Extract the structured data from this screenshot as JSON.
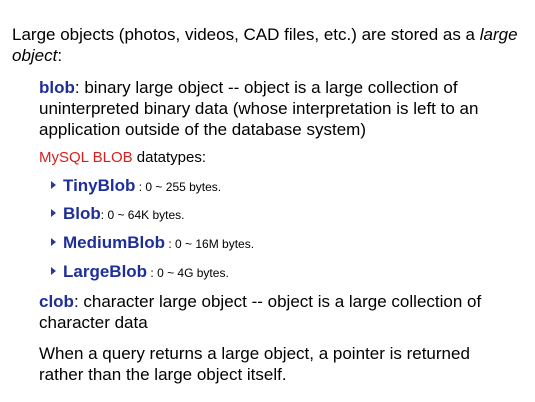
{
  "intro": {
    "text_before": "Large objects (photos, videos, CAD files, etc.) are stored as a ",
    "italic": "large object",
    "text_after": ":"
  },
  "blob": {
    "term": "blob",
    "definition": ": binary large object -- object is a large collection of uninterpreted binary data (whose interpretation is left to an application outside of the database system)"
  },
  "mysql": {
    "prefix": "MySQL  BLOB",
    "suffix": " datatypes:"
  },
  "datatypes": [
    {
      "name": "TinyBlob",
      "range": " :  0 ~ 255 bytes."
    },
    {
      "name": "Blob",
      "range": ": 0 ~ 64K bytes."
    },
    {
      "name": "MediumBlob",
      "range": " : 0 ~ 16M bytes."
    },
    {
      "name": "LargeBlob",
      "range": " : 0 ~ 4G  bytes."
    }
  ],
  "clob": {
    "term": "clob",
    "definition": ": character large object -- object is a large collection of character data"
  },
  "note": "When a query returns a large object, a pointer is returned rather than the large object itself."
}
